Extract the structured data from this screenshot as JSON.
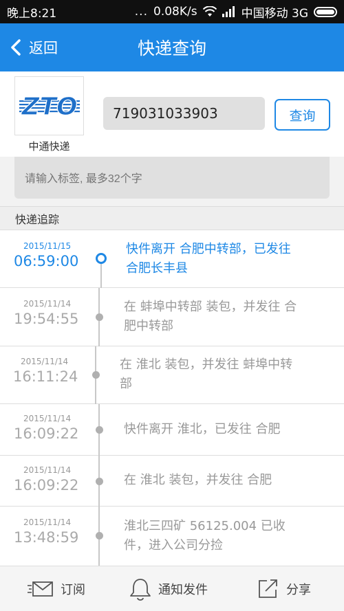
{
  "statusbar": {
    "time": "晚上8:21",
    "dots": "...",
    "speed": "0.08K/s",
    "carrier": "中国移动 3G"
  },
  "header": {
    "back_label": "返回",
    "title": "快递查询"
  },
  "query": {
    "logo_text": "ZTO",
    "company_name": "中通快递",
    "tracking_number": "719031033903",
    "query_button": "查询",
    "tag_placeholder": "请输入标签, 最多32个字"
  },
  "section_title": "快递追踪",
  "events": [
    {
      "date": "2015/11/15",
      "time": "06:59:00",
      "desc_line1": "快件离开 合肥中转部，已发往",
      "desc_line2": "合肥长丰县"
    },
    {
      "date": "2015/11/14",
      "time": "19:54:55",
      "desc_line1": "在 蚌埠中转部 装包，并发往 合",
      "desc_line2": "肥中转部"
    },
    {
      "date": "2015/11/14",
      "time": "16:11:24",
      "desc_line1": "在 淮北 装包，并发往 蚌埠中转",
      "desc_line2": "部"
    },
    {
      "date": "2015/11/14",
      "time": "16:09:22",
      "desc_line1": "快件离开 淮北，已发往 合肥",
      "desc_line2": ""
    },
    {
      "date": "2015/11/14",
      "time": "16:09:22",
      "desc_line1": "在 淮北 装包，并发往 合肥",
      "desc_line2": ""
    },
    {
      "date": "2015/11/14",
      "time": "13:48:59",
      "desc_line1": "淮北三四矿 56125.004 已收",
      "desc_line2": "件，进入公司分捡"
    }
  ],
  "bottom_tabs": {
    "subscribe": "订阅",
    "notify": "通知发件",
    "share": "分享"
  },
  "colors": {
    "accent": "#1e88e5",
    "muted": "#999999"
  }
}
